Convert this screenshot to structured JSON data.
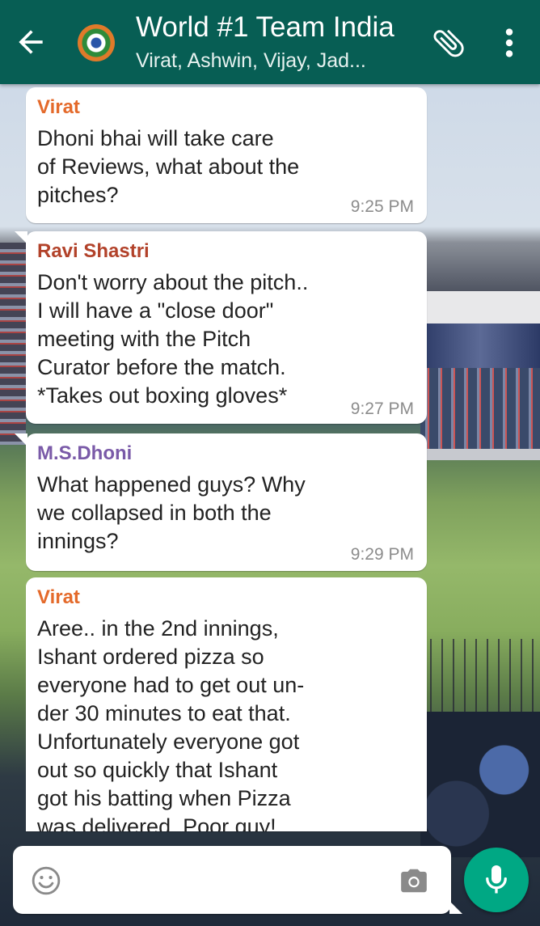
{
  "header": {
    "title": "World #1 Team India",
    "subtitle": "Virat, Ashwin, Vijay, Jad..."
  },
  "messages": [
    {
      "sender": "Virat",
      "sender_color": "#e46a2b",
      "text": "Dhoni bhai will take care\nof Reviews, what about the\npitches?",
      "time": "9:25 PM"
    },
    {
      "sender": "Ravi Shastri",
      "sender_color": "#b2422a",
      "text": "Don't worry about the pitch..\nI will have a \"close door\"\nmeeting with the Pitch\nCurator before the match.\n*Takes out boxing gloves*",
      "time": "9:27 PM"
    },
    {
      "sender": "M.S.Dhoni",
      "sender_color": "#7a5aa8",
      "text": "What happened guys? Why\nwe collapsed in both the\ninnings?",
      "time": "9:29 PM"
    },
    {
      "sender": "Virat",
      "sender_color": "#e46a2b",
      "text": "Aree.. in the 2nd innings,\nIshant ordered pizza so\neveryone had to get out un-\nder 30 minutes to eat that.\nUnfortunately everyone got\nout so quickly that Ishant\ngot his batting when Pizza\nwas delivered. Poor guy!",
      "time": ""
    }
  ],
  "input": {
    "value": ""
  },
  "icons": {
    "back": "arrow-left-icon",
    "attach": "paperclip-icon",
    "menu": "more-vertical-icon",
    "emoji": "emoji-icon",
    "camera": "camera-icon",
    "mic": "mic-icon"
  },
  "colors": {
    "header": "#075e54",
    "mic_button": "#00a884",
    "bubble": "#ffffff",
    "timestamp": "#8c8c8c"
  }
}
